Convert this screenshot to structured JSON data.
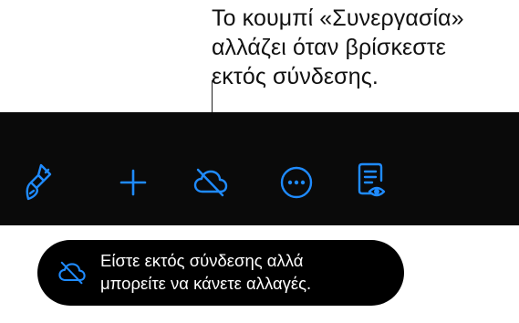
{
  "callout": {
    "lines": [
      "Το κουμπί «Συνεργασία»",
      "αλλάζει όταν βρίσκεστε",
      "εκτός σύνδεσης."
    ]
  },
  "toolbar": {
    "background": "#0a0a0a",
    "accent": "#1f8bff",
    "buttons": [
      {
        "icon": "paintbrush-icon"
      },
      {
        "icon": "plus-icon"
      },
      {
        "icon": "cloud-offline-icon"
      },
      {
        "icon": "more-icon"
      },
      {
        "icon": "document-view-icon"
      }
    ]
  },
  "banner": {
    "background": "#000000",
    "icon": "cloud-offline-icon",
    "lines": [
      "Είστε εκτός σύνδεσης αλλά",
      "μπορείτε να κάνετε αλλαγές."
    ]
  }
}
